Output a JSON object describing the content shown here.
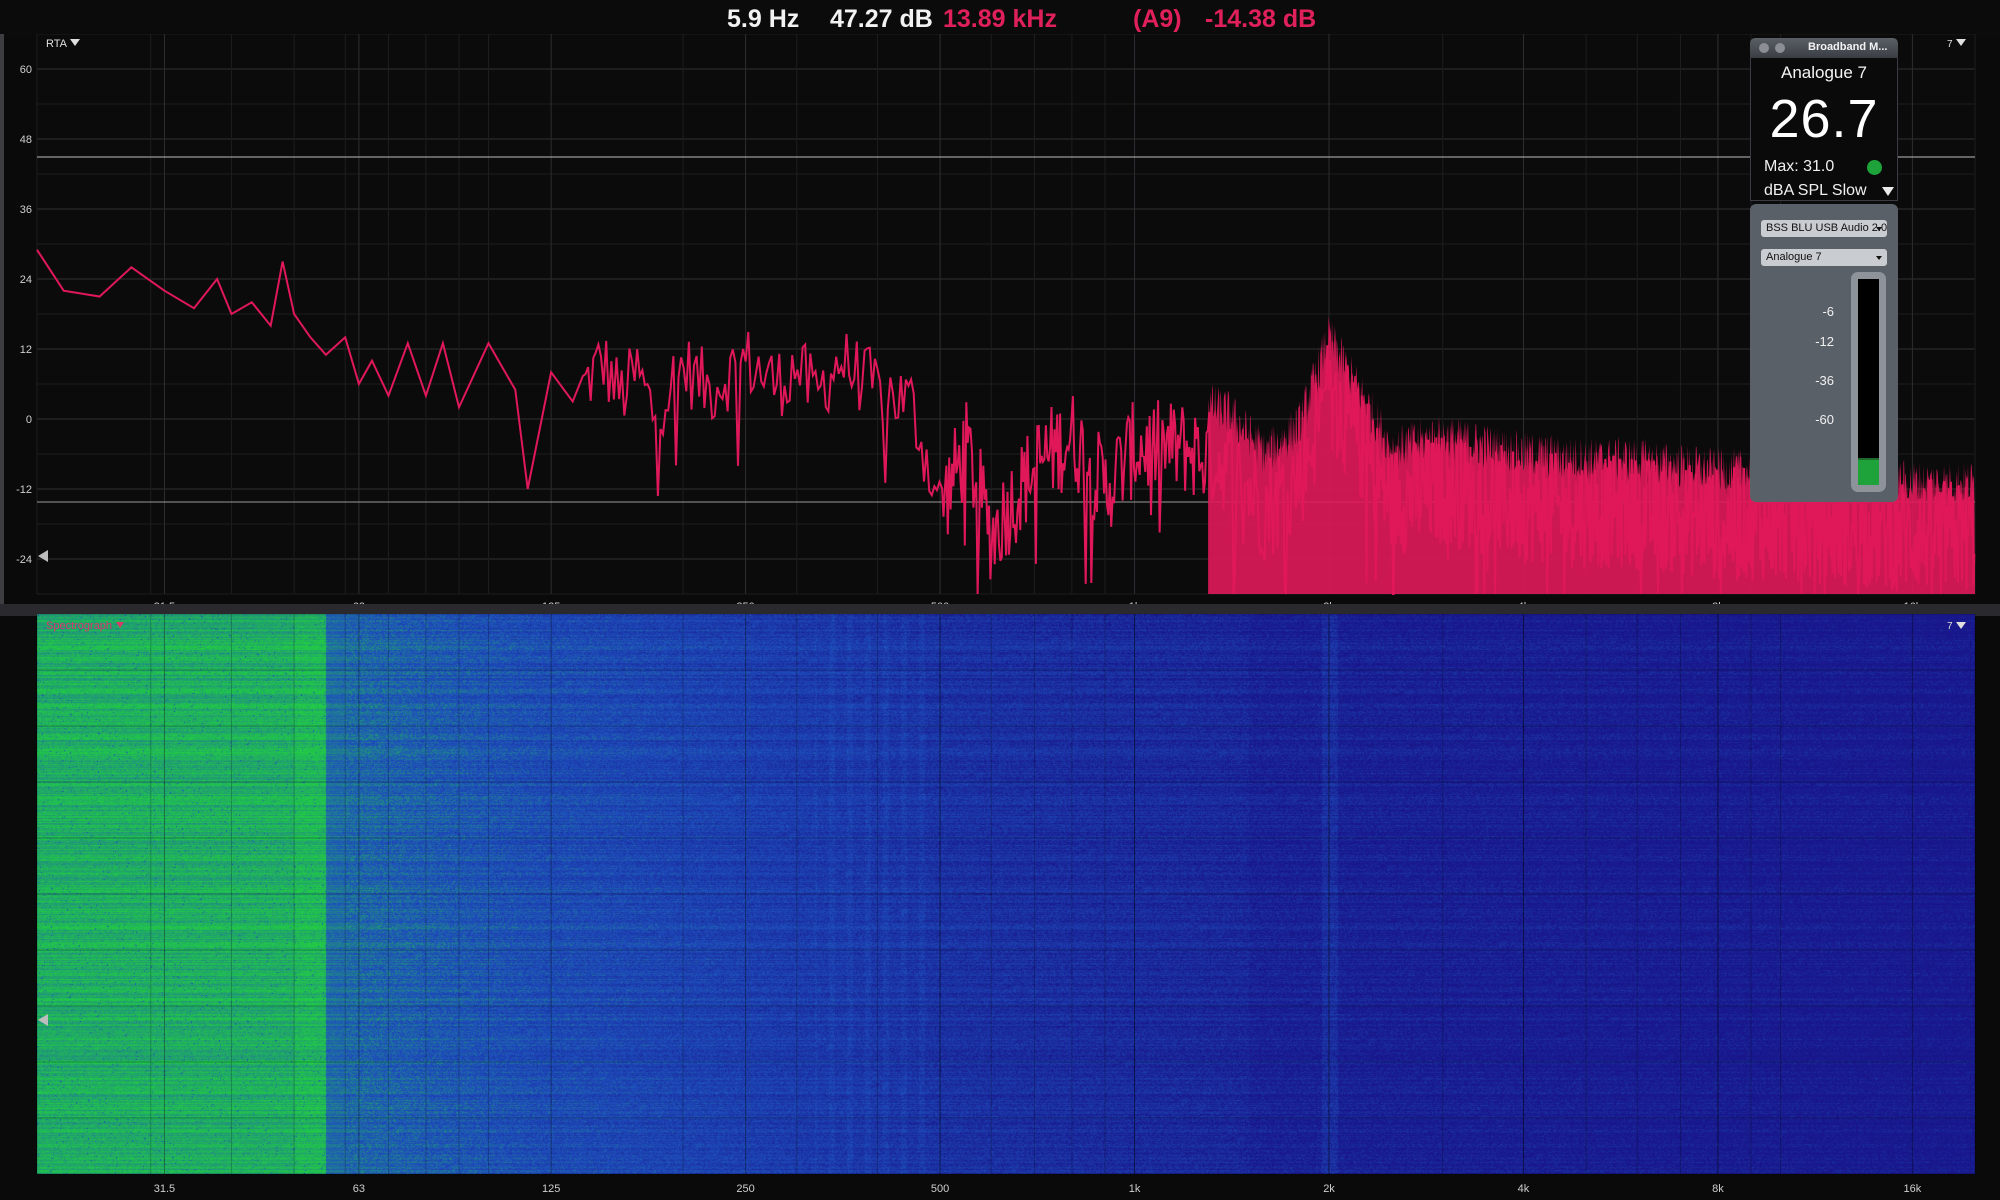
{
  "readouts": {
    "frequency": "5.9 Hz",
    "level": "47.27 dB",
    "peak_freq": "13.89 kHz",
    "weighting": "(A9)",
    "weighted_level": "-14.38 dB"
  },
  "rta_panel": {
    "label": "RTA",
    "menu_label": "7",
    "y_ticks": [
      "60",
      "48",
      "36",
      "24",
      "12",
      "0",
      "-12",
      "-24"
    ],
    "y_tick_values": [
      60,
      48,
      36,
      24,
      12,
      0,
      -12,
      -24
    ]
  },
  "spectrograph_panel": {
    "label": "Spectrograph",
    "menu_label": "7"
  },
  "freq_ticks": [
    "31.5",
    "63",
    "125",
    "250",
    "500",
    "1k",
    "2k",
    "4k",
    "8k",
    "16k"
  ],
  "freq_tick_values": [
    31.5,
    63,
    125,
    250,
    500,
    1000,
    2000,
    4000,
    8000,
    16000
  ],
  "broadband_meter": {
    "title": "Broadband M...",
    "channel": "Analogue 7",
    "value": "26.7",
    "max_text": "Max: 31.0",
    "mode": "dBA SPL Slow",
    "device_select": "BSS BLU USB Audio 2.0",
    "channel_select": "Analogue 7",
    "meter_ticks": [
      "-6",
      "-12",
      "-36",
      "-60"
    ],
    "meter_level_fraction": 0.12,
    "status_color": "#1ea33a"
  },
  "colors": {
    "trace": "#e0185a",
    "background": "#0a0a0b",
    "grid": "#2a2a2a",
    "spectro_low": "#18168a",
    "spectro_high": "#22cc44"
  },
  "chart_data": {
    "type": "line",
    "xscale": "log",
    "xlim": [
      20,
      20000
    ],
    "ylim": [
      -30,
      66
    ],
    "x": [
      20,
      22,
      25,
      28,
      31.5,
      35,
      38,
      40,
      43,
      46,
      48,
      50,
      53,
      56,
      60,
      63,
      66,
      70,
      75,
      80,
      85,
      90,
      100,
      110,
      115,
      125,
      135,
      150,
      160,
      170,
      180,
      200,
      220,
      250,
      280,
      300,
      320,
      350,
      400,
      450,
      500,
      550,
      600,
      700,
      800,
      900,
      1000,
      1200,
      1400,
      1600,
      1800,
      2000,
      2500,
      3000,
      4000,
      5000,
      6000,
      8000,
      10000,
      12500,
      16000,
      20000
    ],
    "y": [
      29,
      22,
      21,
      26,
      22,
      19,
      24,
      18,
      20,
      16,
      27,
      18,
      14,
      11,
      14,
      6,
      10,
      4,
      13,
      4,
      13,
      2,
      13,
      5,
      -12,
      8,
      3,
      10,
      4,
      8,
      1,
      9,
      5,
      10,
      6,
      9,
      4,
      10,
      5,
      3,
      -15,
      -5,
      -20,
      -8,
      -3,
      -12,
      -5,
      -5,
      -8,
      -15,
      -10,
      5,
      -14,
      -12,
      -15,
      -16,
      -16,
      -18,
      -18,
      -19,
      -20,
      -20
    ]
  }
}
